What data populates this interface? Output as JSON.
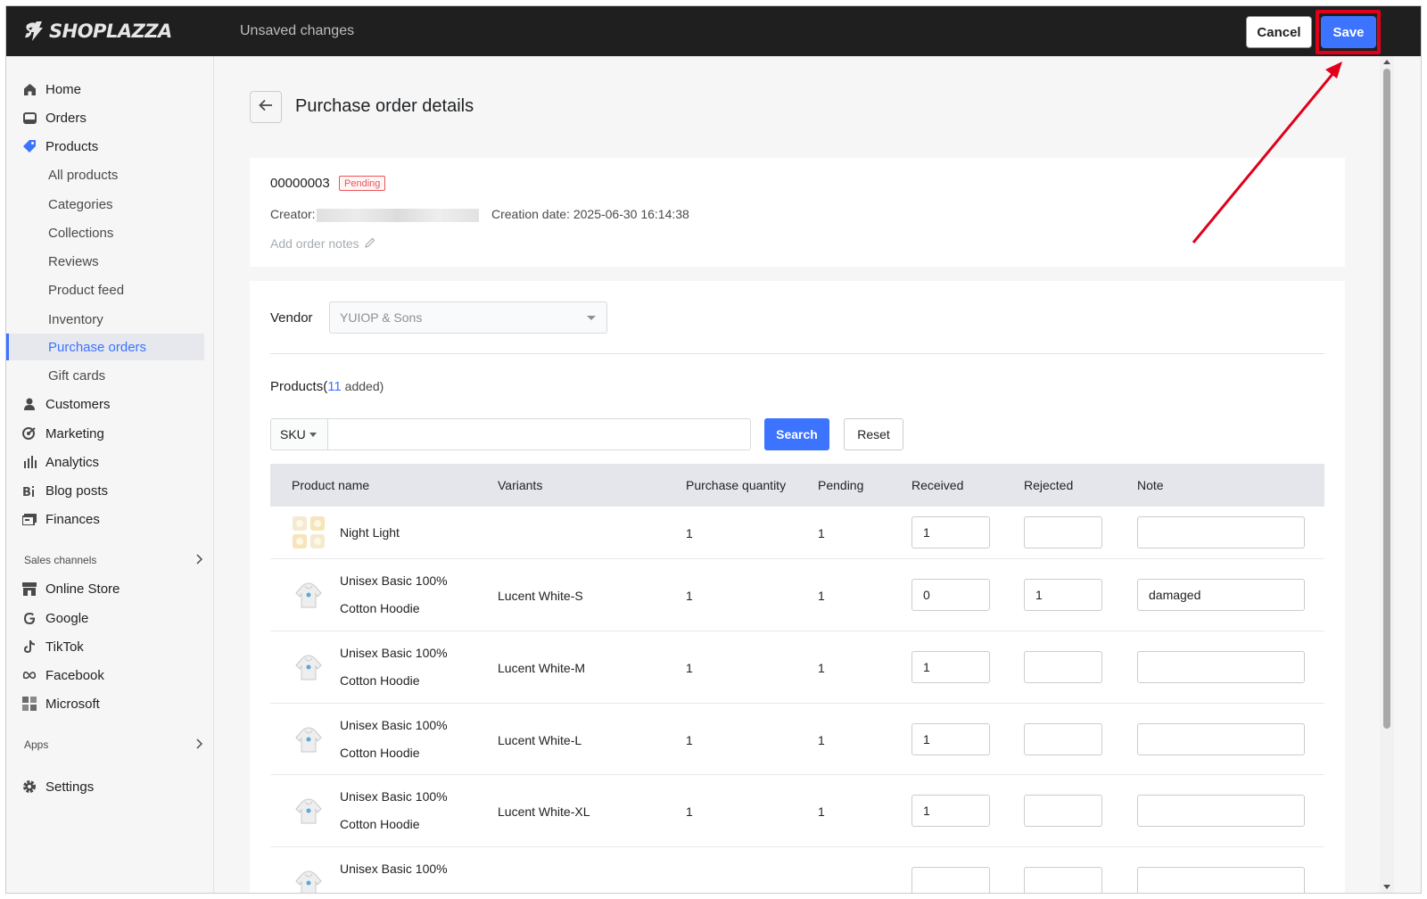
{
  "topbar": {
    "logo_text": "SHOPLAZZA",
    "status": "Unsaved changes",
    "cancel_label": "Cancel",
    "save_label": "Save"
  },
  "sidebar": {
    "items": [
      {
        "label": "Home",
        "icon": "home-icon"
      },
      {
        "label": "Orders",
        "icon": "orders-icon"
      },
      {
        "label": "Products",
        "icon": "tag-icon"
      },
      {
        "label": "All products"
      },
      {
        "label": "Categories"
      },
      {
        "label": "Collections"
      },
      {
        "label": "Reviews"
      },
      {
        "label": "Product feed"
      },
      {
        "label": "Inventory"
      },
      {
        "label": "Purchase orders",
        "active": true
      },
      {
        "label": "Gift cards"
      },
      {
        "label": "Customers",
        "icon": "person-icon"
      },
      {
        "label": "Marketing",
        "icon": "marketing-icon"
      },
      {
        "label": "Analytics",
        "icon": "analytics-icon"
      },
      {
        "label": "Blog posts",
        "icon": "blog-icon"
      },
      {
        "label": "Finances",
        "icon": "finances-icon"
      }
    ],
    "sales_channels_label": "Sales channels",
    "channels": [
      {
        "label": "Online Store",
        "icon": "store-icon"
      },
      {
        "label": "Google",
        "icon": "google-icon"
      },
      {
        "label": "TikTok",
        "icon": "tiktok-icon"
      },
      {
        "label": "Facebook",
        "icon": "meta-icon"
      },
      {
        "label": "Microsoft",
        "icon": "microsoft-icon"
      }
    ],
    "apps_label": "Apps",
    "settings_label": "Settings"
  },
  "page": {
    "title": "Purchase order details",
    "order_number": "00000003",
    "status_badge": "Pending",
    "creator_label": "Creator:",
    "creation_date": "Creation date: 2025-06-30 16:14:38",
    "add_notes": "Add order notes",
    "vendor_label": "Vendor",
    "vendor_value": "YUIOP & Sons",
    "products_label": "Products(",
    "products_count": "11",
    "products_added": " added)",
    "sku_label": "SKU",
    "search_label": "Search",
    "reset_label": "Reset"
  },
  "table": {
    "headers": [
      "Product name",
      "Variants",
      "Purchase quantity",
      "Pending",
      "Received",
      "Rejected",
      "Note"
    ],
    "rows": [
      {
        "name_line1": "Night Light",
        "name_line2": "",
        "variant": "",
        "qty": "1",
        "pending": "1",
        "received": "1",
        "rejected": "",
        "note": ""
      },
      {
        "name_line1": "Unisex Basic 100%",
        "name_line2": "Cotton Hoodie",
        "variant": "Lucent White-S",
        "qty": "1",
        "pending": "1",
        "received": "0",
        "rejected": "1",
        "note": "damaged"
      },
      {
        "name_line1": "Unisex Basic 100%",
        "name_line2": "Cotton Hoodie",
        "variant": "Lucent White-M",
        "qty": "1",
        "pending": "1",
        "received": "1",
        "rejected": "",
        "note": ""
      },
      {
        "name_line1": "Unisex Basic 100%",
        "name_line2": "Cotton Hoodie",
        "variant": "Lucent White-L",
        "qty": "1",
        "pending": "1",
        "received": "1",
        "rejected": "",
        "note": ""
      },
      {
        "name_line1": "Unisex Basic 100%",
        "name_line2": "Cotton Hoodie",
        "variant": "Lucent White-XL",
        "qty": "1",
        "pending": "1",
        "received": "1",
        "rejected": "",
        "note": ""
      },
      {
        "name_line1": "Unisex Basic 100%",
        "name_line2": "",
        "variant": "",
        "qty": "",
        "pending": "",
        "received": "",
        "rejected": "",
        "note": ""
      }
    ]
  },
  "colors": {
    "accent": "#3c73ff",
    "topbar": "#1f1f1f",
    "highlight": "#e0001b",
    "pending": "#e8565c"
  }
}
